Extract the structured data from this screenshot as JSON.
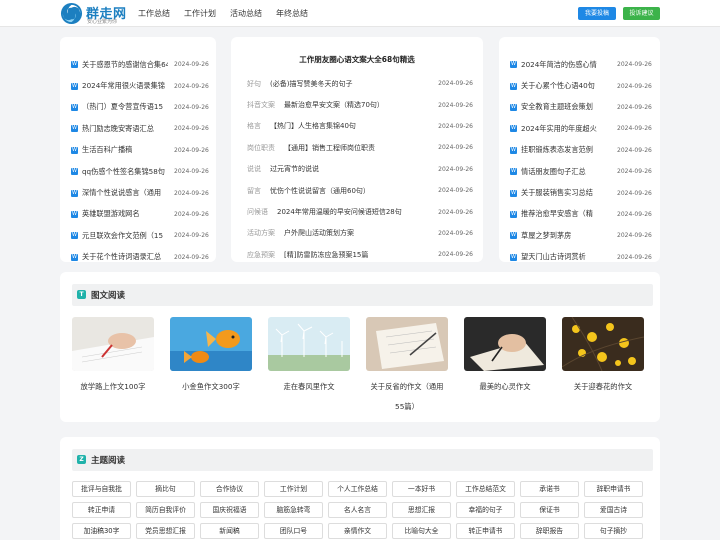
{
  "header": {
    "logo_title": "群走网",
    "logo_sub": "安心业繁为你",
    "nav": [
      "工作总结",
      "工作计划",
      "活动总结",
      "年终总结"
    ],
    "btn_submit": "我要投稿",
    "btn_feedback": "投诉建议"
  },
  "left_list": [
    {
      "title": "关于感恩节的感谢信合集64",
      "date": "2024-09-26"
    },
    {
      "title": "2024年常用很火语录集锦",
      "date": "2024-09-26"
    },
    {
      "title": "（热门）夏令营宣传语15",
      "date": "2024-09-26"
    },
    {
      "title": "热门励志晚安寄语汇总",
      "date": "2024-09-26"
    },
    {
      "title": "生活百科广播稿",
      "date": "2024-09-26"
    },
    {
      "title": "qq伤感个性签名集锦58句",
      "date": "2024-09-26"
    },
    {
      "title": "深情个性说说感言（通用",
      "date": "2024-09-26"
    },
    {
      "title": "英雄联盟游戏网名",
      "date": "2024-09-26"
    },
    {
      "title": "元旦联欢会作文范例（15",
      "date": "2024-09-26"
    },
    {
      "title": "关于花个性诗词语录汇总",
      "date": "2024-09-26"
    }
  ],
  "mid": {
    "title": "工作朋友圈心语文案大全68句精选",
    "items": [
      {
        "tag": "好句",
        "title": "(必备)描写赞美冬天的句子",
        "date": "2024-09-26"
      },
      {
        "tag": "抖音文案",
        "title": "最新治愈早安文案（精选70句）",
        "date": "2024-09-26"
      },
      {
        "tag": "格言",
        "title": "【热门】人生格言集锦40句",
        "date": "2024-09-26"
      },
      {
        "tag": "岗位职责",
        "title": "【通用】销售工程师岗位职责",
        "date": "2024-09-26"
      },
      {
        "tag": "说说",
        "title": "过元宵节的说说",
        "date": "2024-09-26"
      },
      {
        "tag": "留言",
        "title": "忧伤个性说说留言（通用60句）",
        "date": "2024-09-26"
      },
      {
        "tag": "问候语",
        "title": "2024年常用温暖的早安问候语短信28句",
        "date": "2024-09-26"
      },
      {
        "tag": "活动方案",
        "title": "户外爬山活动策划方案",
        "date": "2024-09-26"
      },
      {
        "tag": "应急预案",
        "title": "[精]防雷防冻应急预案15篇",
        "date": "2024-09-26"
      }
    ]
  },
  "right_list": [
    {
      "title": "2024年简洁的伤感心情",
      "date": "2024-09-26"
    },
    {
      "title": "关于心累个性心语40句",
      "date": "2024-09-26"
    },
    {
      "title": "安全教育主题班会策划",
      "date": "2024-09-26"
    },
    {
      "title": "2024年实用的年度超火",
      "date": "2024-09-26"
    },
    {
      "title": "挂职锻炼表态发言范例",
      "date": "2024-09-26"
    },
    {
      "title": "情话朋友圈句子汇总",
      "date": "2024-09-26"
    },
    {
      "title": "关于服装销售实习总结",
      "date": "2024-09-26"
    },
    {
      "title": "推荐治愈早安感言（精",
      "date": "2024-09-26"
    },
    {
      "title": "草屋之梦到茅房",
      "date": "2024-09-26"
    },
    {
      "title": "望天门山古诗词赏析",
      "date": "2024-09-26"
    }
  ],
  "pic_section": {
    "badge": "T",
    "title": "图文阅读",
    "items": [
      {
        "caption": "放学路上作文100字",
        "icon": "writing-hand-image"
      },
      {
        "caption": "小金鱼作文300字",
        "icon": "goldfish-image"
      },
      {
        "caption": "走在春风里作文",
        "icon": "wind-turbines-image"
      },
      {
        "caption": "关于反省的作文（通用55篇）",
        "icon": "notebook-image"
      },
      {
        "caption": "最美的心灵作文",
        "icon": "hand-pen-image"
      },
      {
        "caption": "关于迎春花的作文",
        "icon": "yellow-flowers-image"
      }
    ]
  },
  "topic_section": {
    "badge": "Z",
    "title": "主题阅读",
    "tags": [
      "批评与自我批",
      "摘比句",
      "合作协议",
      "工作计划",
      "个人工作总结",
      "一本好书",
      "工作总结范文",
      "承诺书",
      "辞职申请书",
      "转正申请",
      "简历自我评价",
      "国庆祝福语",
      "脑筋急转弯",
      "名人名言",
      "思想汇报",
      "幸福的句子",
      "保证书",
      "爱国古诗",
      "加油稿30字",
      "党员思想汇报",
      "新闻稿",
      "团队口号",
      "亲情作文",
      "比喻句大全",
      "转正申请书",
      "辞职报告",
      "句子摘抄"
    ]
  },
  "colors": {
    "accent": "#1e88e5",
    "green": "#3cb34a",
    "teal": "#20b2aa"
  }
}
